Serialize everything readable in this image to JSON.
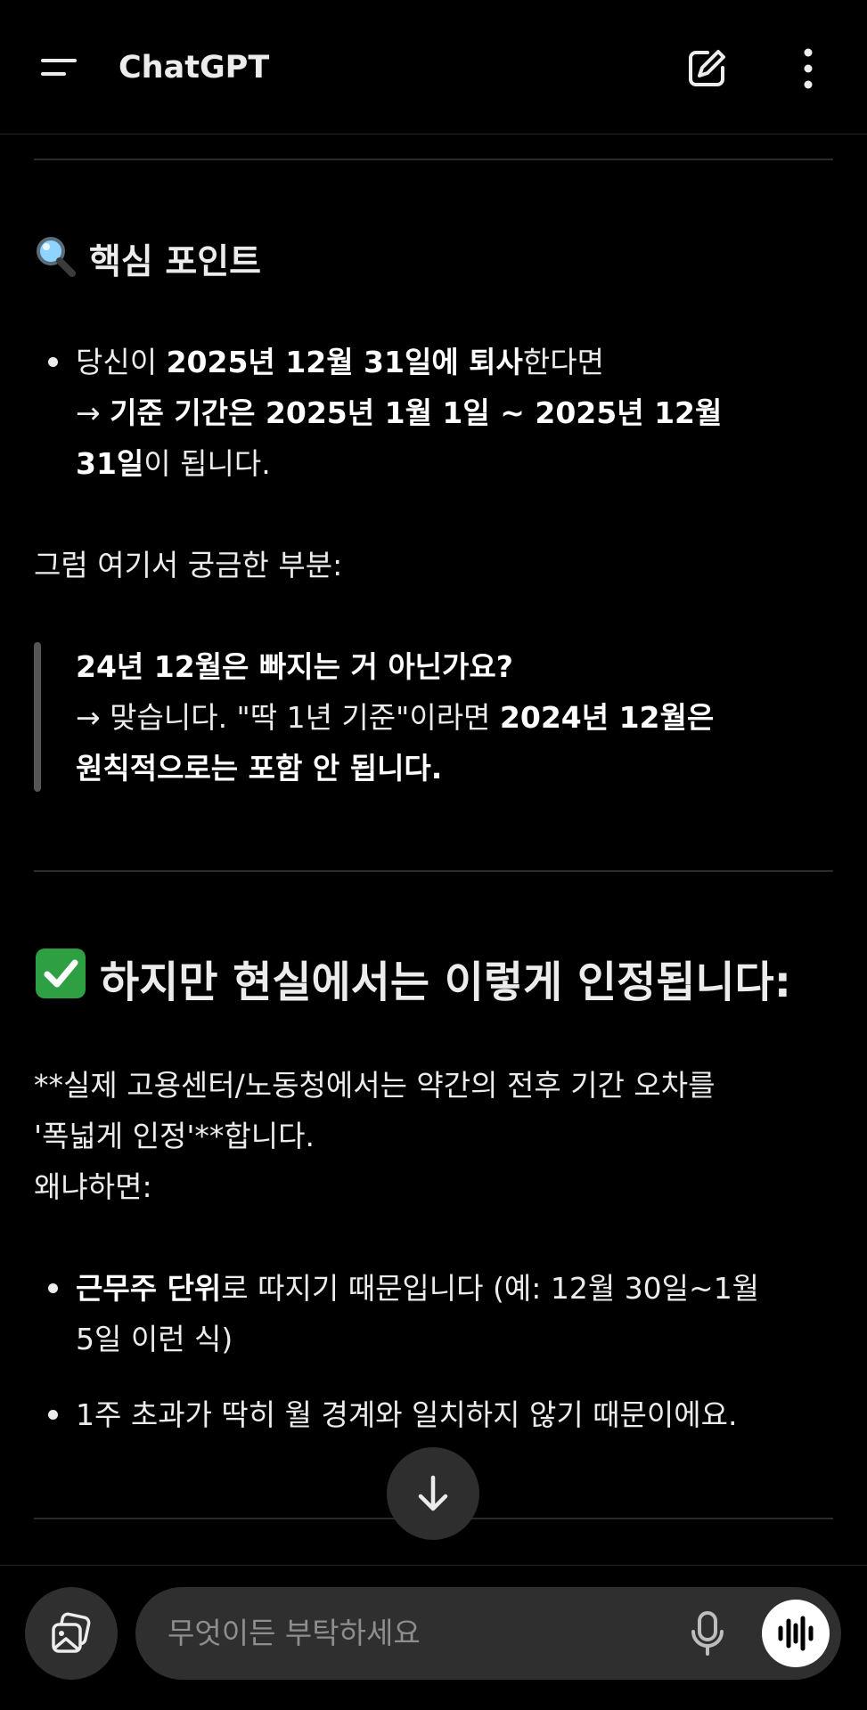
{
  "header": {
    "title": "ChatGPT"
  },
  "section1": {
    "icon": "magnifier-emoji",
    "heading": "핵심 포인트",
    "bullet1": {
      "line1": [
        {
          "t": "당신이 "
        },
        {
          "b": "2025년 12월 31일에 퇴사"
        },
        {
          "t": "한다면"
        }
      ],
      "line2": [
        {
          "t": "→ "
        },
        {
          "b": "기준 기간은 2025년 1월 1일 ~ 2025년 12월"
        }
      ],
      "line3": [
        {
          "b": "31일"
        },
        {
          "t": "이 됩니다."
        }
      ]
    },
    "intro": "그럼 여기서 궁금한 부분:",
    "quote": {
      "line1": [
        {
          "b": "24년 12월은 빠지는 거 아닌가요?"
        }
      ],
      "line2": [
        {
          "t": "→ 맞습니다. \"딱 1년 기준\"이라면 "
        },
        {
          "b": "2024년 12월은"
        }
      ],
      "line3": [
        {
          "b": "원칙적으로는 포함 안 됩니다."
        }
      ]
    }
  },
  "section2": {
    "icon": "check-mark-emoji",
    "heading": "하지만 현실에서는 이렇게 인정됩니다:",
    "para": {
      "line1": "**실제 고용센터/노동청에서는 약간의 전후 기간 오차를",
      "line2": "'폭넓게 인정'**합니다.",
      "line3": "왜냐하면:"
    },
    "bullet1": {
      "line1": [
        {
          "b": "근무주 단위"
        },
        {
          "t": "로 따지기 때문입니다 (예: 12월 30일~1월"
        }
      ],
      "line2": [
        {
          "t": "5일 이런 식)"
        }
      ]
    },
    "bullet2": {
      "line1": [
        {
          "t": "1주 초과가 딱히 월 경계와 일치하지 않기 때문이에요."
        }
      ]
    }
  },
  "composer": {
    "placeholder": "무엇이든 부탁하세요"
  },
  "colors": {
    "background": "#000000",
    "text": "#ececec",
    "surface": "#2f2f2f",
    "check": "#2ea043"
  }
}
